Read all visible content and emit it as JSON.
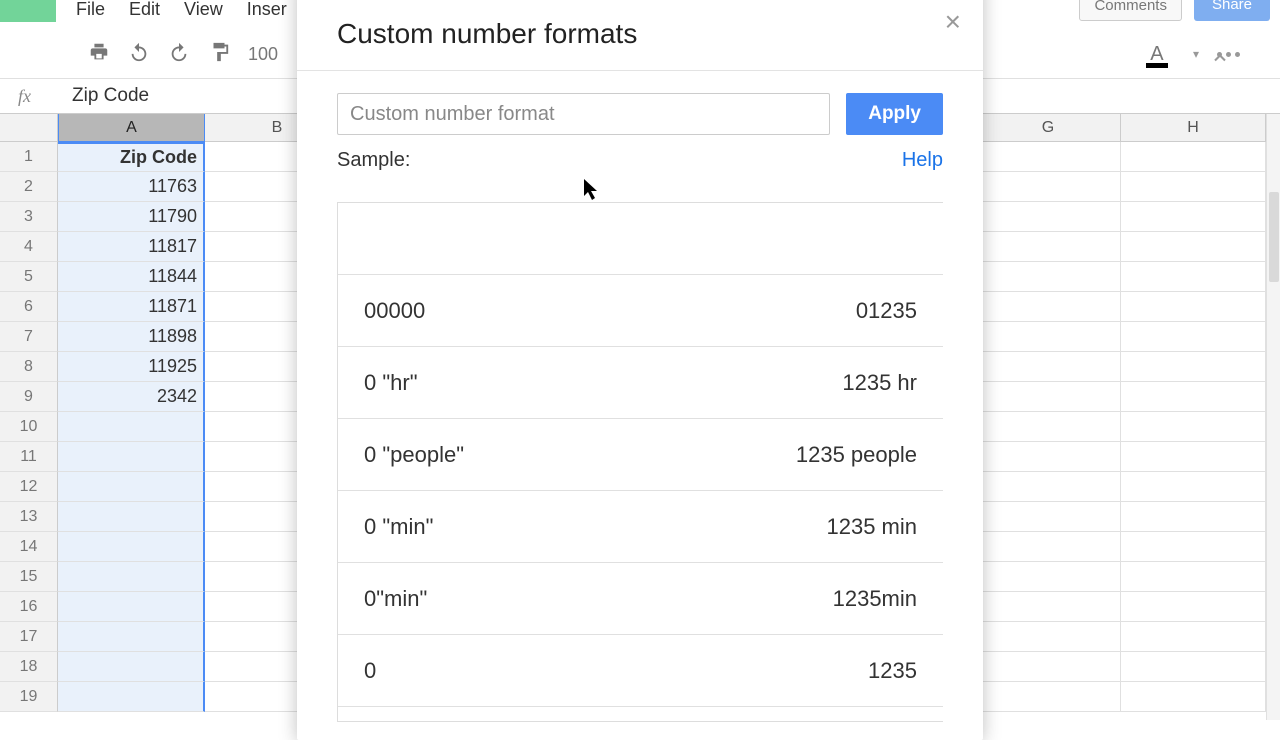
{
  "menubar": {
    "file": "File",
    "edit": "Edit",
    "view": "View",
    "insert": "Inser"
  },
  "topRight": {
    "comments": "Comments",
    "share": "Share"
  },
  "toolbar": {
    "zoom": "100"
  },
  "fx": {
    "label": "fx",
    "value": "Zip Code"
  },
  "columns": {
    "A": "A",
    "B": "B",
    "G": "G",
    "H": "H"
  },
  "rows": [
    {
      "n": "1",
      "a": "Zip Code"
    },
    {
      "n": "2",
      "a": "11763"
    },
    {
      "n": "3",
      "a": "11790"
    },
    {
      "n": "4",
      "a": "11817"
    },
    {
      "n": "5",
      "a": "11844"
    },
    {
      "n": "6",
      "a": "11871"
    },
    {
      "n": "7",
      "a": "11898"
    },
    {
      "n": "8",
      "a": "11925"
    },
    {
      "n": "9",
      "a": "2342"
    },
    {
      "n": "10",
      "a": ""
    },
    {
      "n": "11",
      "a": ""
    },
    {
      "n": "12",
      "a": ""
    },
    {
      "n": "13",
      "a": ""
    },
    {
      "n": "14",
      "a": ""
    },
    {
      "n": "15",
      "a": ""
    },
    {
      "n": "16",
      "a": ""
    },
    {
      "n": "17",
      "a": ""
    },
    {
      "n": "18",
      "a": ""
    },
    {
      "n": "19",
      "a": ""
    }
  ],
  "dialog": {
    "title": "Custom number formats",
    "placeholder": "Custom number format",
    "apply": "Apply",
    "sample": "Sample:",
    "help": "Help",
    "formats": [
      {
        "pattern": "",
        "example": ""
      },
      {
        "pattern": "00000",
        "example": "01235"
      },
      {
        "pattern": "0 \"hr\"",
        "example": "1235 hr"
      },
      {
        "pattern": "0 \"people\"",
        "example": "1235 people"
      },
      {
        "pattern": "0 \"min\"",
        "example": "1235 min"
      },
      {
        "pattern": "0\"min\"",
        "example": "1235min"
      },
      {
        "pattern": "0",
        "example": "1235"
      }
    ]
  }
}
